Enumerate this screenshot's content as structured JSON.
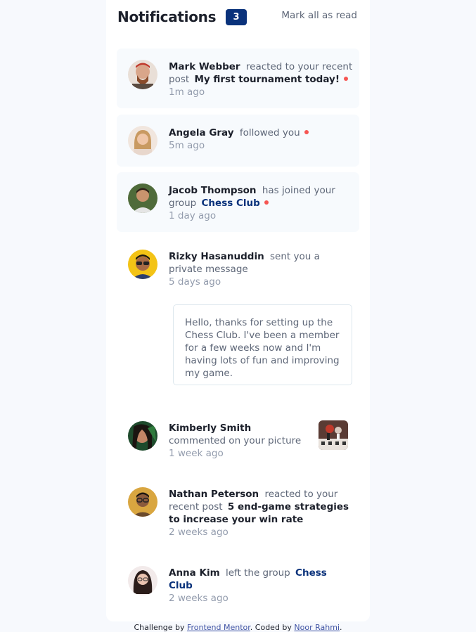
{
  "header": {
    "title": "Notifications",
    "count": "3",
    "mark_all": "Mark all as read"
  },
  "notifications": [
    {
      "name": "Mark Webber",
      "action": "reacted to your recent post",
      "target": "My first tournament today!",
      "time": "1m ago"
    },
    {
      "name": "Angela Gray",
      "action": "followed you",
      "time": "5m ago"
    },
    {
      "name": "Jacob Thompson",
      "action": "has joined your group",
      "target": "Chess Club",
      "time": "1 day ago"
    },
    {
      "name": "Rizky Hasanuddin",
      "action": "sent you a private message",
      "time": "5 days ago",
      "message": "Hello, thanks for setting up the Chess Club. I've been a member for a few weeks now and I'm having lots of fun and improving my game."
    },
    {
      "name": "Kimberly Smith",
      "action": "commented on your picture",
      "time": "1 week ago"
    },
    {
      "name": "Nathan Peterson",
      "action": "reacted to your recent post",
      "target": "5 end-game strategies to increase your win rate",
      "time": "2 weeks ago"
    },
    {
      "name": "Anna Kim",
      "action": "left the group",
      "target": "Chess Club",
      "time": "2 weeks ago"
    }
  ],
  "footer": {
    "prefix": "Challenge by",
    "link1": "Frontend Mentor",
    "middle": ". Coded by",
    "link2": "Noor Rahmi",
    "suffix": "."
  },
  "colors": {
    "unread_bg": "#f7fafd",
    "badge": "#0a327b",
    "dot": "#f65552",
    "text": "#1c202b",
    "muted": "#5e6778"
  }
}
